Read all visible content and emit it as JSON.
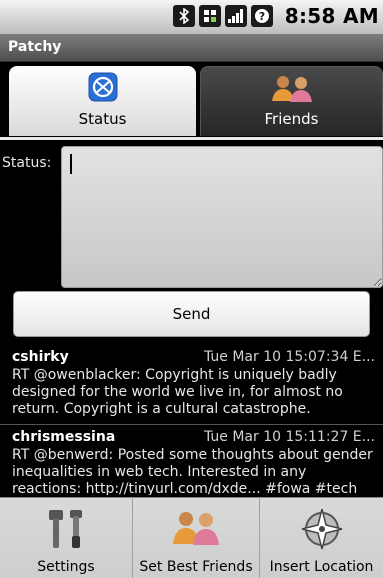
{
  "status_bar": {
    "icons": [
      "bluetooth-icon",
      "data-icon",
      "signal-icon",
      "sim-icon"
    ],
    "time": "8:58 AM"
  },
  "app": {
    "title": "Patchy"
  },
  "tabs": [
    {
      "label": "Status",
      "icon": "status-globe-icon",
      "selected": true
    },
    {
      "label": "Friends",
      "icon": "friends-people-icon",
      "selected": false
    }
  ],
  "status": {
    "label": "Status:",
    "value": "",
    "send_label": "Send"
  },
  "timeline": [
    {
      "user": "cshirky",
      "date": "Tue Mar 10 15:07:34 E...",
      "text": "RT @owenblacker: Copyright is uniquely badly designed for the world we live in, for almost no return. Copyright is a cultural catastrophe."
    },
    {
      "user": "chrismessina",
      "date": "Tue Mar 10 15:11:27 E...",
      "text": "RT @benwerd: Posted some thoughts about gender inequalities in web tech. Interested in any reactions: http://tinyurl.com/dxde... #fowa #tech"
    }
  ],
  "menu": [
    {
      "label": "Settings",
      "icon": "wrench-icon"
    },
    {
      "label": "Set Best Friends",
      "icon": "friends-people-icon"
    },
    {
      "label": "Insert Location",
      "icon": "compass-icon"
    }
  ],
  "colors": {
    "accent_blue": "#2a6fd6",
    "friends_orange": "#e89a3a",
    "friends_pink": "#e07a9a"
  }
}
